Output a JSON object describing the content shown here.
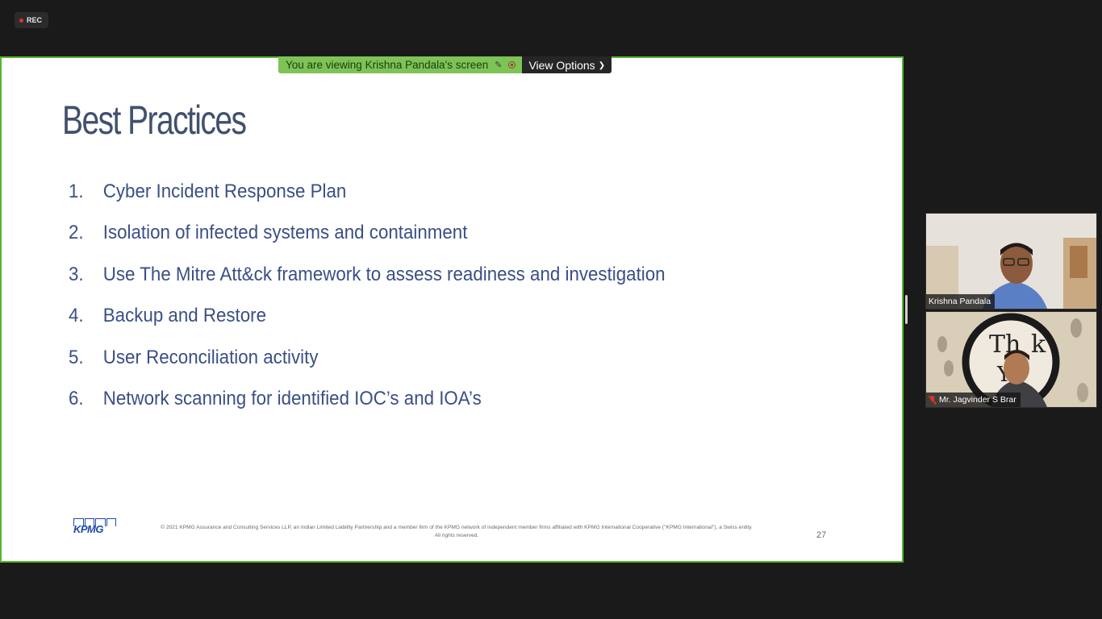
{
  "recording": {
    "label": "REC",
    "dot_color": "#e0322c"
  },
  "banner": {
    "viewing_text": "You are viewing Krishna Pandala's screen",
    "view_options_label": "View Options",
    "banner_color": "#7dc356",
    "icons": [
      "pencil-icon",
      "stop-share-icon",
      "chevron-down-icon"
    ]
  },
  "slide": {
    "title": "Best Practices",
    "items": [
      {
        "number": "1.",
        "text": "Cyber Incident Response Plan"
      },
      {
        "number": "2.",
        "text": "Isolation of infected systems and containment"
      },
      {
        "number": "3.",
        "text": "Use The Mitre Att&ck framework to assess readiness and investigation"
      },
      {
        "number": "4.",
        "text": "Backup and Restore"
      },
      {
        "number": "5.",
        "text": "User Reconciliation activity"
      },
      {
        "number": "6.",
        "text": "Network scanning for identified IOC’s and IOA’s"
      }
    ],
    "logo_text": "KPMG",
    "copyright": "© 2021 KPMG Assurance and Consulting Services LLP, an Indian Limited Liability Partnership and a member firm of the KPMG network of independent member firms affiliated with KPMG International Cooperative (\"KPMG International\"), a Swiss entity. All rights reserved.",
    "page_number": "27",
    "text_color": "#3a4f86",
    "frame_color": "#54b82e"
  },
  "participants": [
    {
      "name": "Krishna Pandala",
      "muted": false
    },
    {
      "name": "Mr. Jagvinder S Brar",
      "muted": true
    }
  ]
}
